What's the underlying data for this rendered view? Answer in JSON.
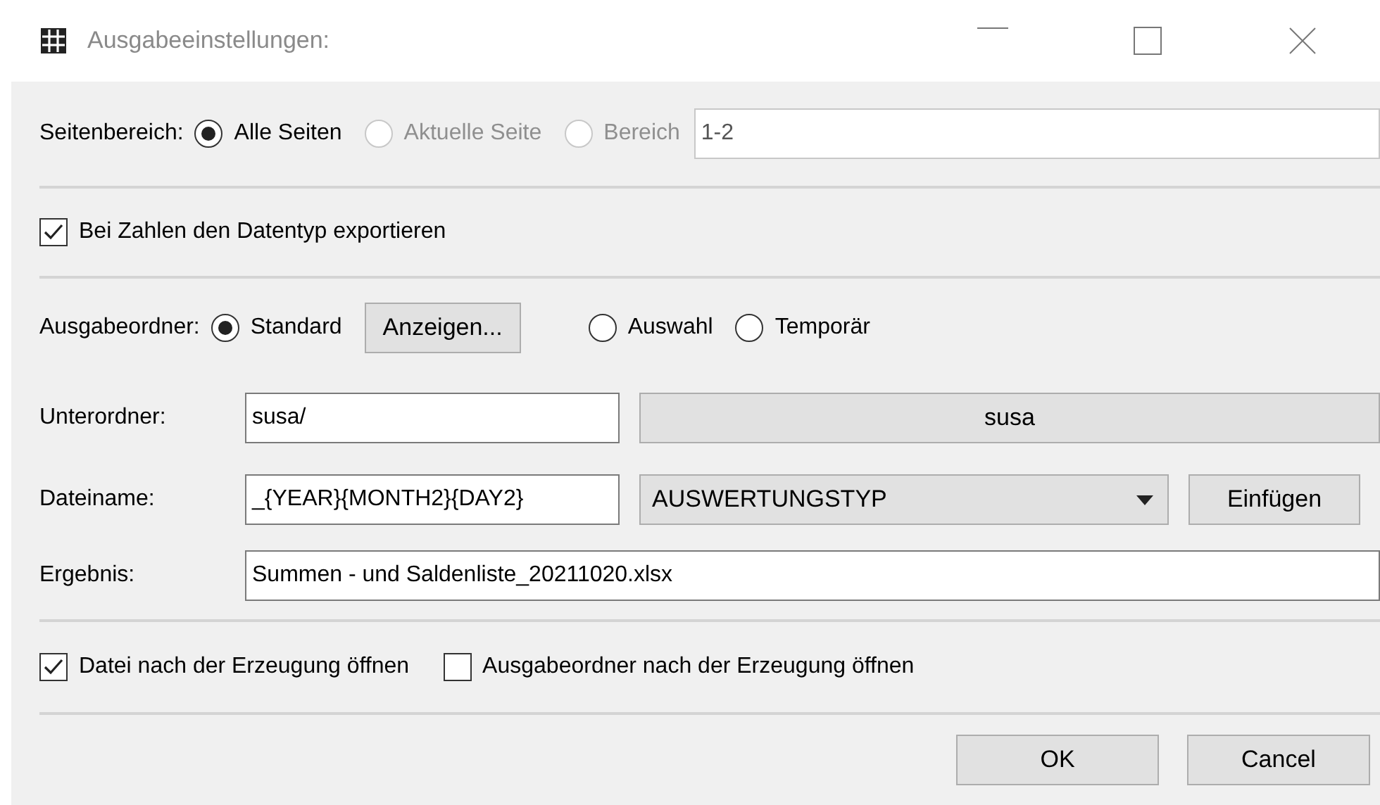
{
  "window": {
    "title": "Ausgabeeinstellungen:"
  },
  "page_range": {
    "label": "Seitenbereich:",
    "options": [
      {
        "label": "Alle Seiten",
        "selected": true,
        "disabled": false
      },
      {
        "label": "Aktuelle Seite",
        "selected": false,
        "disabled": true
      },
      {
        "label": "Bereich",
        "selected": false,
        "disabled": true
      }
    ],
    "range_value": "1-2"
  },
  "export_datatype": {
    "label": "Bei Zahlen den Datentyp exportieren",
    "checked": true
  },
  "output_folder": {
    "label": "Ausgabeordner:",
    "options": [
      {
        "label": "Standard",
        "selected": true
      },
      {
        "label": "Auswahl",
        "selected": false
      },
      {
        "label": "Temporär",
        "selected": false
      }
    ],
    "show_button": "Anzeigen..."
  },
  "subfolder": {
    "label": "Unterordner:",
    "value": "susa/",
    "button": "susa"
  },
  "filename": {
    "label": "Dateiname:",
    "value": "_{YEAR}{MONTH2}{DAY2}",
    "dropdown": "AUSWERTUNGSTYP",
    "button": "Einfügen"
  },
  "result": {
    "label": "Ergebnis:",
    "value": "Summen - und Saldenliste_20211020.xlsx"
  },
  "open_options": [
    {
      "label": "Datei nach der Erzeugung öffnen",
      "checked": true
    },
    {
      "label": "Ausgabeordner nach der Erzeugung öffnen",
      "checked": false
    }
  ],
  "buttons": [
    "OK",
    "Cancel"
  ]
}
